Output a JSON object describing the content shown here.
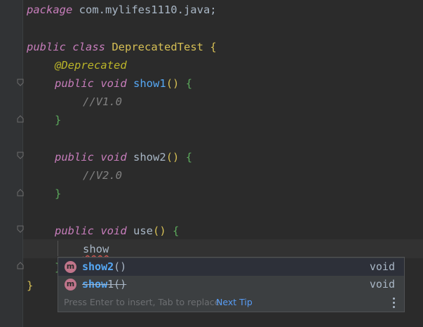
{
  "editor": {
    "lines": {
      "l1": {
        "kw": "package",
        "rest": " com.mylifes1110.java;"
      },
      "l3": {
        "kw1": "public",
        "kw2": "class",
        "name": " DeprecatedTest ",
        "brace": "{"
      },
      "l4": {
        "ann": "@Deprecated"
      },
      "l5": {
        "kw1": "public",
        "kw2": "void",
        "fn": "show1",
        "paren": "()",
        "brace": "{"
      },
      "l6": {
        "comment": "//V1.0"
      },
      "l7": {
        "brace": "}"
      },
      "l9": {
        "kw1": "public",
        "kw2": "void",
        "fn": "show2",
        "paren": "()",
        "brace": "{"
      },
      "l10": {
        "comment": "//V2.0"
      },
      "l11": {
        "brace": "}"
      },
      "l13": {
        "kw1": "public",
        "kw2": "void",
        "fn": "use",
        "paren": "()",
        "brace": "{"
      },
      "l14": {
        "typed": "show"
      },
      "l15": {
        "brace": "}"
      },
      "l16": {
        "brace": "}"
      }
    }
  },
  "completion": {
    "items": [
      {
        "badge": "m",
        "name_bold": "show",
        "name_rest": "2",
        "params": "()",
        "type": "void",
        "deprecated": false
      },
      {
        "badge": "m",
        "name_bold": "show",
        "name_rest": "1",
        "params": "()",
        "type": "void",
        "deprecated": true
      }
    ],
    "tip_text": "Press Enter to insert, Tab to replace",
    "tip_link": "Next Tip"
  }
}
